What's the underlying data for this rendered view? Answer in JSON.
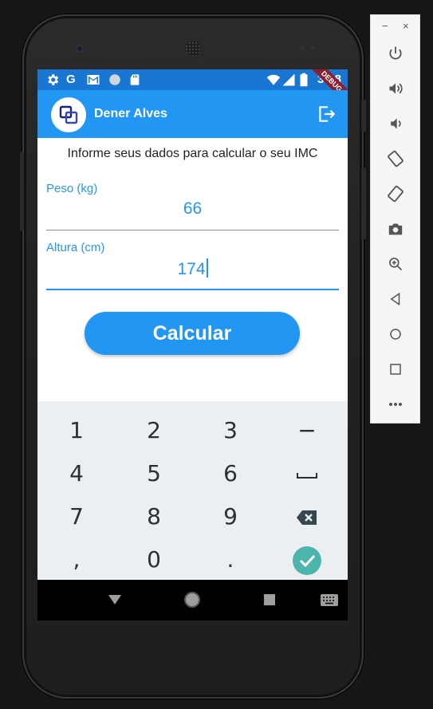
{
  "status_bar": {
    "time": "3:28",
    "left_icons": [
      "gear-icon",
      "google-icon",
      "gmail-icon",
      "circle-icon",
      "sd-card-icon"
    ],
    "right_icons": [
      "wifi-icon",
      "signal-icon",
      "battery-icon"
    ],
    "debug_banner": "DEBUG",
    "color": "#1976d2"
  },
  "app_bar": {
    "title": "Dener Alves",
    "logo_icon": "app-logo-icon",
    "action_icon": "logout-icon",
    "color": "#2196f3"
  },
  "form": {
    "instruction": "Informe seus dados para calcular o seu IMC",
    "weight": {
      "label": "Peso (kg)",
      "value": "66"
    },
    "height": {
      "label": "Altura (cm)",
      "value": "174"
    },
    "submit_label": "Calcular"
  },
  "keyboard": {
    "keys": [
      "1",
      "2",
      "3",
      "−",
      "4",
      "5",
      "6",
      "␣",
      "7",
      "8",
      "9",
      "⌫",
      ",",
      "0",
      ".",
      "✓"
    ],
    "done_color": "#4db6ac"
  },
  "emulator_panel": {
    "minimize": "−",
    "close": "×",
    "tools": [
      "power-icon",
      "volume-up-icon",
      "volume-down-icon",
      "rotate-left-icon",
      "rotate-right-icon",
      "camera-icon",
      "zoom-icon",
      "back-icon",
      "home-icon",
      "overview-icon",
      "more-icon"
    ]
  }
}
